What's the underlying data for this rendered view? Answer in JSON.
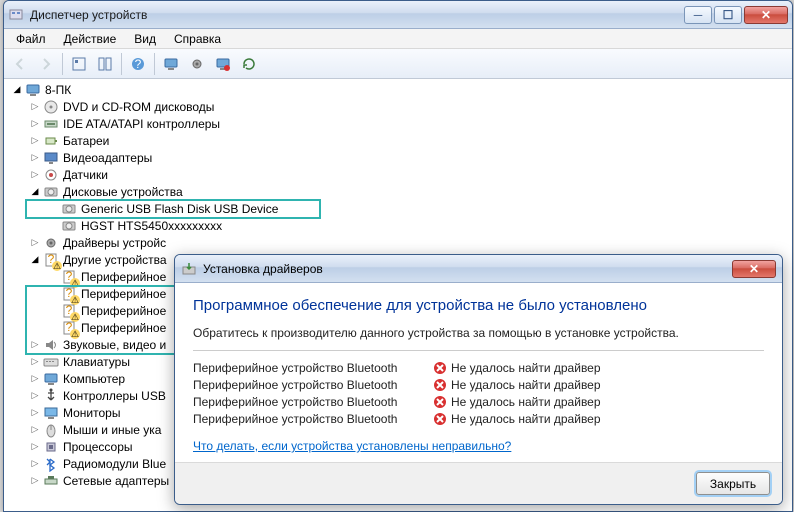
{
  "window": {
    "title": "Диспетчер устройств"
  },
  "menus": [
    "Файл",
    "Действие",
    "Вид",
    "Справка"
  ],
  "tree": {
    "root": "8-ПК",
    "nodes": [
      {
        "label": "DVD и CD-ROM дисководы",
        "icon": "disc"
      },
      {
        "label": "IDE ATA/ATAPI контроллеры",
        "icon": "ide"
      },
      {
        "label": "Батареи",
        "icon": "battery"
      },
      {
        "label": "Видеоадаптеры",
        "icon": "display"
      },
      {
        "label": "Датчики",
        "icon": "sensor"
      },
      {
        "label": "Дисковые устройства",
        "icon": "hdd",
        "expanded": true,
        "children": [
          {
            "label": "Generic USB Flash Disk USB Device",
            "icon": "hdd"
          },
          {
            "label": "HGST HTS5450xxxxxxxxx",
            "icon": "hdd"
          }
        ]
      },
      {
        "label": "Драйверы устройс",
        "icon": "gear"
      },
      {
        "label": "Другие устройства",
        "icon": "unknown",
        "expanded": true,
        "warning": true,
        "children": [
          {
            "label": "Периферийное",
            "icon": "unknown",
            "warning": true
          },
          {
            "label": "Периферийное",
            "icon": "unknown",
            "warning": true
          },
          {
            "label": "Периферийное",
            "icon": "unknown",
            "warning": true
          },
          {
            "label": "Периферийное",
            "icon": "unknown",
            "warning": true
          }
        ]
      },
      {
        "label": "Звуковые, видео и",
        "icon": "sound"
      },
      {
        "label": "Клавиатуры",
        "icon": "keyboard"
      },
      {
        "label": "Компьютер",
        "icon": "computer"
      },
      {
        "label": "Контроллеры USB",
        "icon": "usb"
      },
      {
        "label": "Мониторы",
        "icon": "monitor"
      },
      {
        "label": "Мыши и иные ука",
        "icon": "mouse"
      },
      {
        "label": "Процессоры",
        "icon": "cpu"
      },
      {
        "label": "Радиомодули Blue",
        "icon": "bluetooth"
      },
      {
        "label": "Сетевые адаптеры",
        "icon": "network"
      }
    ]
  },
  "dialog": {
    "title": "Установка драйверов",
    "heading": "Программное обеспечение для устройства не было установлено",
    "subtitle": "Обратитесь к производителю данного устройства за помощью в установке устройства.",
    "rows": [
      {
        "device": "Периферийное устройство Bluetooth",
        "status": "Не удалось найти драйвер"
      },
      {
        "device": "Периферийное устройство Bluetooth",
        "status": "Не удалось найти драйвер"
      },
      {
        "device": "Периферийное устройство Bluetooth",
        "status": "Не удалось найти драйвер"
      },
      {
        "device": "Периферийное устройство Bluetooth",
        "status": "Не удалось найти драйвер"
      }
    ],
    "link": "Что делать, если устройства установлены неправильно?",
    "close_btn": "Закрыть"
  }
}
